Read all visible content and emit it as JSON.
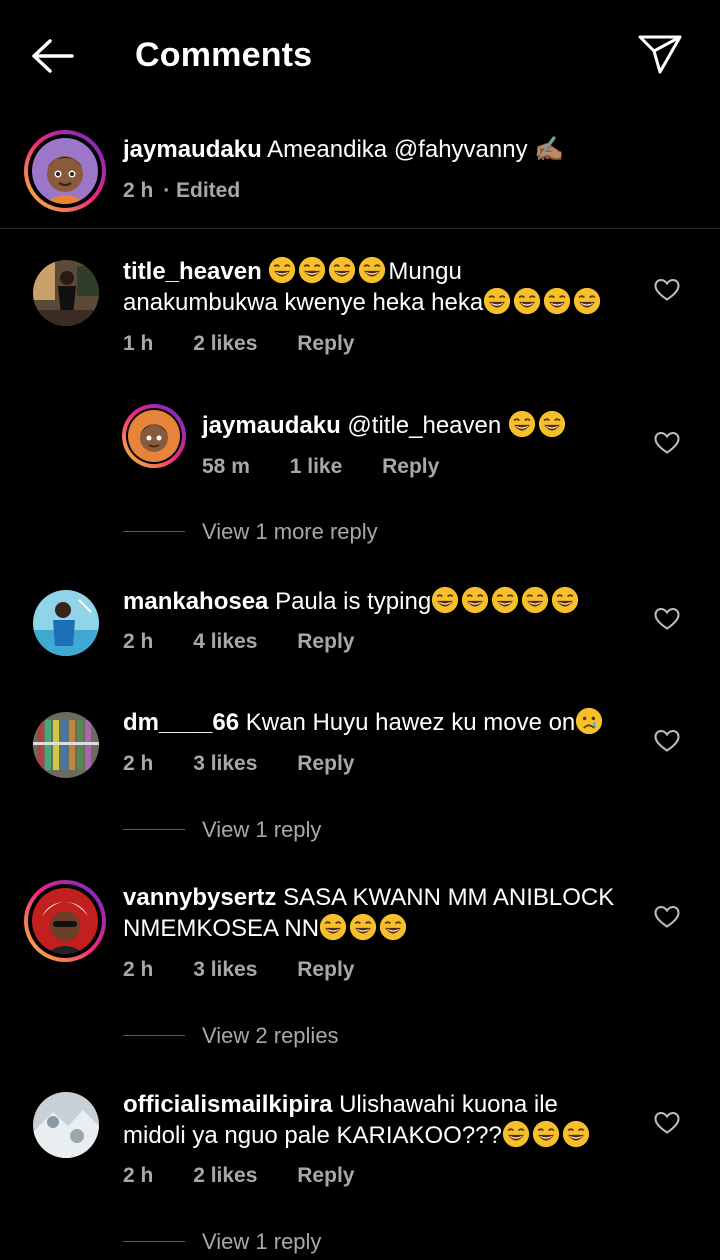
{
  "header": {
    "title": "Comments"
  },
  "caption": {
    "user": "jaymaudaku",
    "text": "Ameandika @fahyvanny ✍🏽",
    "time": "2 h",
    "edited": "· Edited"
  },
  "comments": [
    {
      "user": "title_heaven",
      "text_a": "Mungu",
      "text_b": "anakumbukwa kwenye heka heka",
      "time": "1 h",
      "likes": "2 likes",
      "reply": "Reply"
    },
    {
      "user": "jaymaudaku",
      "text": "@title_heaven",
      "time": "58 m",
      "likes": "1 like",
      "reply": "Reply"
    },
    {
      "view": "View 1 more reply"
    },
    {
      "user": "mankahosea",
      "text": "Paula is typing",
      "time": "2 h",
      "likes": "4 likes",
      "reply": "Reply"
    },
    {
      "user": "dm____66",
      "text": "Kwan Huyu hawez ku move on",
      "time": "2 h",
      "likes": "3 likes",
      "reply": "Reply",
      "view": "View 1 reply"
    },
    {
      "user": "vannybysertz",
      "text_a": "SASA KWANN MM ANIBLOCK",
      "text_b": "NMEMKOSEA NN",
      "time": "2 h",
      "likes": "3 likes",
      "reply": "Reply",
      "view": "View 2 replies"
    },
    {
      "user": "officialismailkipira",
      "text_a": "Ulishawahi kuona ile",
      "text_b": "midoli ya nguo pale KARIAKOO???",
      "time": "2 h",
      "likes": "2 likes",
      "reply": "Reply",
      "view": "View 1 reply"
    }
  ],
  "colors": {
    "background": "#000000",
    "text": "#ffffff",
    "muted": "#a8a8a8",
    "story_ring": [
      "#f9ce34",
      "#ee2a7b",
      "#6228d7"
    ]
  },
  "icons": [
    "back-arrow-icon",
    "send-icon",
    "heart-icon",
    "laughing-emoji",
    "crying-emoji"
  ]
}
